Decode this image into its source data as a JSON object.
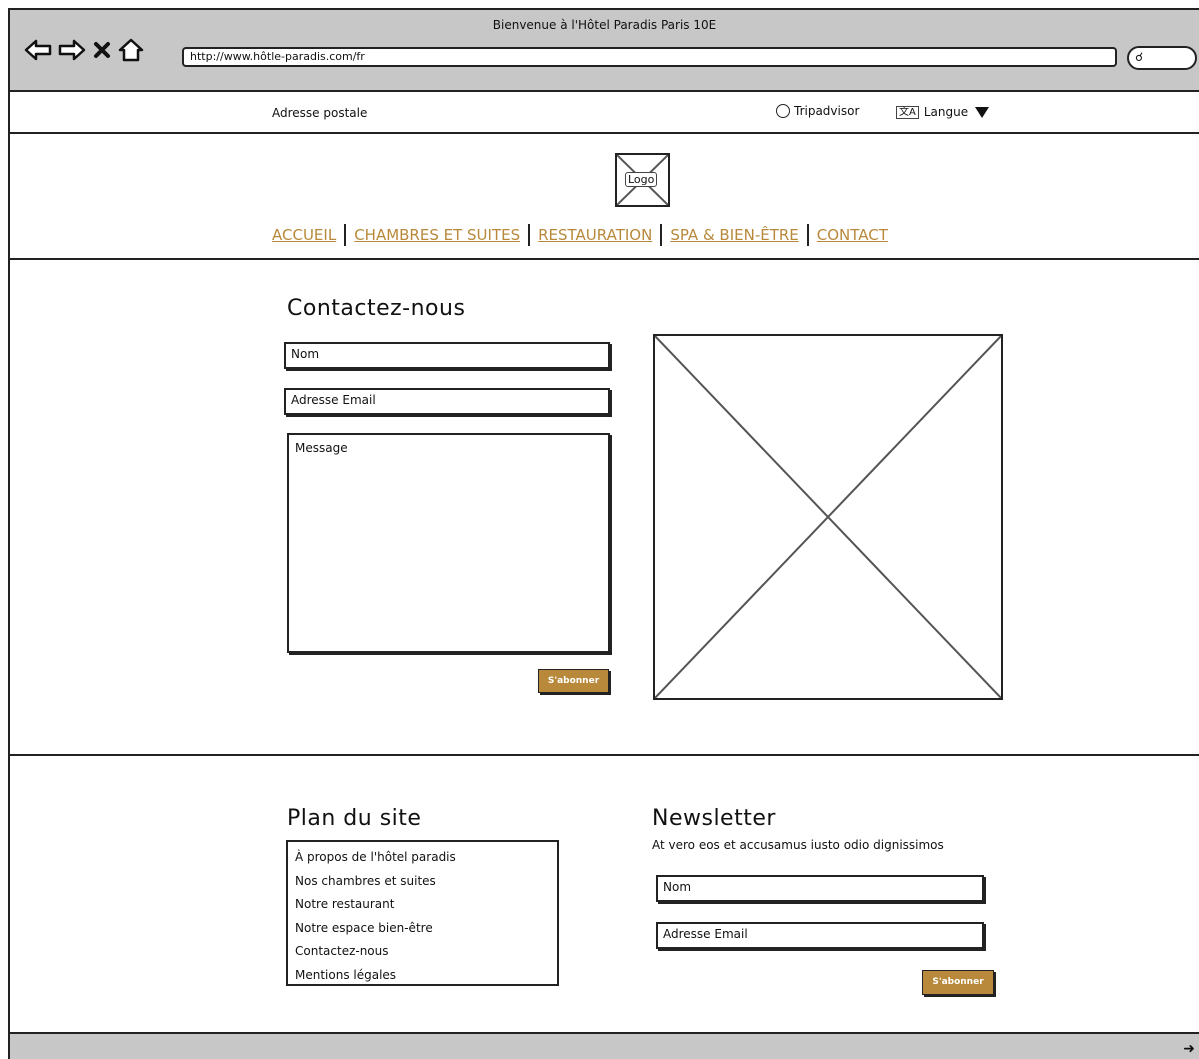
{
  "window": {
    "title": "Bienvenue à l'Hôtel Paradis Paris 10E",
    "url": "http://www.hôtle-paradis.com/fr"
  },
  "topbar": {
    "address": "Adresse postale",
    "tripadvisor": "Tripadvisor",
    "language": "Langue"
  },
  "header": {
    "logo": "Logo",
    "menu": [
      "ACCUEIL",
      "CHAMBRES ET SUITES",
      "RESTAURATION",
      "SPA & BIEN-ÊTRE",
      "CONTACT"
    ]
  },
  "contact": {
    "title": "Contactez-nous",
    "name_placeholder": "Nom",
    "email_placeholder": "Adresse Email",
    "message_placeholder": "Message",
    "submit": "S'abonner"
  },
  "sitemap": {
    "title": "Plan du site",
    "items": [
      "À propos de l'hôtel paradis",
      "Nos chambres et suites",
      "Notre restaurant",
      "Notre espace bien-être",
      "Contactez-nous",
      "Mentions légales"
    ]
  },
  "newsletter": {
    "title": "Newsletter",
    "description": "At vero eos et accusamus iusto odio dignissimos",
    "name_placeholder": "Nom",
    "email_placeholder": "Adresse Email",
    "submit": "S'abonner"
  },
  "colors": {
    "accent": "#b8893a",
    "chrome": "#c7c7c7"
  }
}
